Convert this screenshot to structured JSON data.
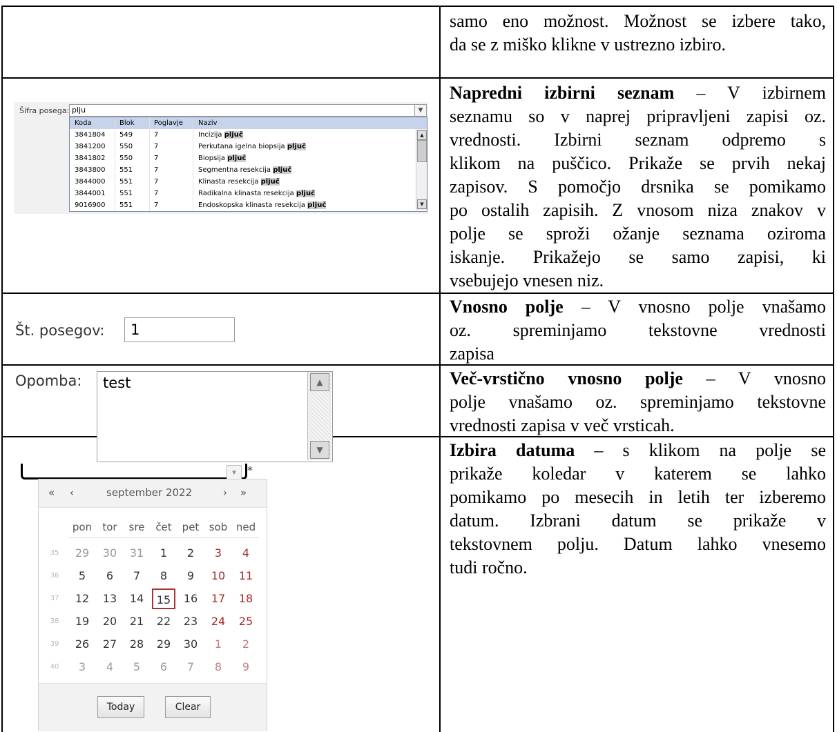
{
  "rows": {
    "r1": {
      "lines": [
        "samo eno možnost. Možnost se izbere tako,",
        "da se z miško klikne v ustrezno izbiro."
      ]
    },
    "r2": {
      "title": "Napredni izbirni seznam",
      "lines": [
        "– V izbirnem",
        "seznamu so v naprej pripravljeni zapisi oz.",
        "vrednosti. Izbirni seznam odpremo s",
        "klikom na puščico. Prikaže se prvih nekaj",
        "zapisov. S pomočjo drsnika se pomikamo",
        "po ostalih zapisih. Z vnosom niza znakov v",
        "polje se sproži ožanje seznama oziroma",
        "iskanje. Prikažejo se samo zapisi, ki",
        "vsebujejo vnesen niz."
      ]
    },
    "r3": {
      "title": "Vnosno polje",
      "lines": [
        "– V vnosno polje vnašamo",
        "oz. spreminjamo tekstovne vrednosti",
        "zapisa"
      ]
    },
    "r4": {
      "title": "Več-vrstično vnosno polje",
      "lines": [
        "– V vnosno",
        "polje vnašamo oz. spreminjamo tekstovne",
        "vrednosti zapisa v več vrsticah."
      ]
    },
    "r5": {
      "title": "Izbira datuma",
      "lines": [
        "– s klikom na polje se",
        "prikaže koledar v katerem se lahko",
        "pomikamo po mesecih in letih ter izberemo",
        "datum. Izbrani datum se prikaže v",
        "tekstovnem polju. Datum lahko vnesemo",
        "tudi ročno."
      ]
    }
  },
  "adv_select": {
    "label": "Šifra posega:",
    "value": "plju",
    "dropdown_icon": "chevron-down-icon",
    "columns": [
      "Koda",
      "Blok",
      "Poglavje",
      "Naziv"
    ],
    "highlight": "pljuč",
    "rows": [
      {
        "koda": "3841804",
        "blok": "549",
        "poglavje": "7",
        "naziv_pre": "Incizija "
      },
      {
        "koda": "3841200",
        "blok": "550",
        "poglavje": "7",
        "naziv_pre": "Perkutana igelna biopsija "
      },
      {
        "koda": "3841802",
        "blok": "550",
        "poglavje": "7",
        "naziv_pre": "Biopsija "
      },
      {
        "koda": "3843800",
        "blok": "551",
        "poglavje": "7",
        "naziv_pre": "Segmentna resekcija "
      },
      {
        "koda": "3844000",
        "blok": "551",
        "poglavje": "7",
        "naziv_pre": "Klinasta resekcija "
      },
      {
        "koda": "3844001",
        "blok": "551",
        "poglavje": "7",
        "naziv_pre": "Radikalna klinasta resekcija "
      },
      {
        "koda": "9016900",
        "blok": "551",
        "poglavje": "7",
        "naziv_pre": "Endoskopska klinasta resekcija "
      }
    ]
  },
  "num_input": {
    "label": "Št. posegov:",
    "value": "1"
  },
  "note": {
    "label": "Opomba:",
    "value": "test"
  },
  "calendar": {
    "nav_prev_year": "«",
    "nav_prev": "‹",
    "month": "september 2022",
    "nav_next": "›",
    "nav_next_year": "»",
    "weekdays": [
      "pon",
      "tor",
      "sre",
      "čet",
      "pet",
      "sob",
      "ned"
    ],
    "weeks": [
      {
        "wk": "35",
        "days": [
          "29",
          "30",
          "31",
          "1",
          "2",
          "3",
          "4"
        ]
      },
      {
        "wk": "36",
        "days": [
          "5",
          "6",
          "7",
          "8",
          "9",
          "10",
          "11"
        ]
      },
      {
        "wk": "37",
        "days": [
          "12",
          "13",
          "14",
          "15",
          "16",
          "17",
          "18"
        ]
      },
      {
        "wk": "38",
        "days": [
          "19",
          "20",
          "21",
          "22",
          "23",
          "24",
          "25"
        ]
      },
      {
        "wk": "39",
        "days": [
          "26",
          "27",
          "28",
          "29",
          "30",
          "1",
          "2"
        ]
      },
      {
        "wk": "40",
        "days": [
          "3",
          "4",
          "5",
          "6",
          "7",
          "8",
          "9"
        ]
      }
    ],
    "selected_day": "15",
    "today_label": "Today",
    "clear_label": "Clear",
    "required_marker": "*"
  }
}
